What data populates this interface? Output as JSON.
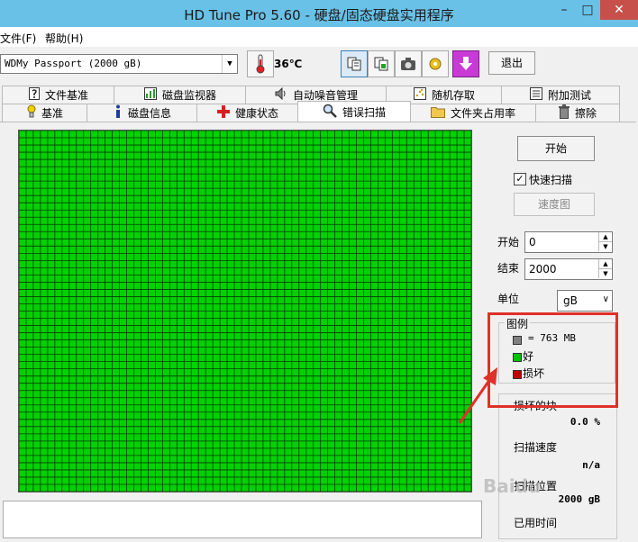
{
  "window": {
    "title": "HD Tune Pro 5.60 - 硬盘/固态硬盘实用程序",
    "min": "–",
    "max": "□",
    "close": "✕"
  },
  "menu": {
    "file": "文件(F)",
    "help": "帮助(H)"
  },
  "toolbar": {
    "drive": "WDMy Passport (2000 gB)",
    "temperature": "36℃",
    "exit": "退出"
  },
  "tabs_top": [
    {
      "label": "文件基准",
      "icon": "file-benchmark-icon"
    },
    {
      "label": "磁盘监视器",
      "icon": "disk-monitor-icon"
    },
    {
      "label": "自动噪音管理",
      "icon": "speaker-icon"
    },
    {
      "label": "随机存取",
      "icon": "random-access-icon"
    },
    {
      "label": "附加测试",
      "icon": "extra-tests-icon"
    }
  ],
  "tabs_bottom": [
    {
      "label": "基准",
      "icon": "benchmark-icon"
    },
    {
      "label": "磁盘信息",
      "icon": "info-icon"
    },
    {
      "label": "健康状态",
      "icon": "health-cross-icon"
    },
    {
      "label": "错误扫描",
      "icon": "magnifier-icon"
    },
    {
      "label": "文件夹占用率",
      "icon": "folder-icon"
    },
    {
      "label": "擦除",
      "icon": "trash-icon"
    }
  ],
  "scan": {
    "start_button": "开始",
    "quick_scan_label": "快速扫描",
    "quick_scan_checked": "✓",
    "speed_map_button": "速度图",
    "start_label": "开始",
    "start_value": "0",
    "end_label": "结束",
    "end_value": "2000",
    "unit_label": "单位",
    "unit_value": "gB",
    "grid_color": "#00d200"
  },
  "legend": {
    "title": "图例",
    "block_size": "= 763 MB",
    "good": "好",
    "damaged": "损坏",
    "colors": {
      "block": "#808080",
      "good": "#00c000",
      "damaged": "#c00000"
    }
  },
  "stats": {
    "damaged_blocks_label": "损坏的块",
    "damaged_blocks_value": "0.0 %",
    "scan_speed_label": "扫描速度",
    "scan_speed_value": "n/a",
    "scan_position_label": "扫描位置",
    "scan_position_value": "2000 gB",
    "elapsed_label": "已用时间"
  },
  "watermark": "Baidu"
}
